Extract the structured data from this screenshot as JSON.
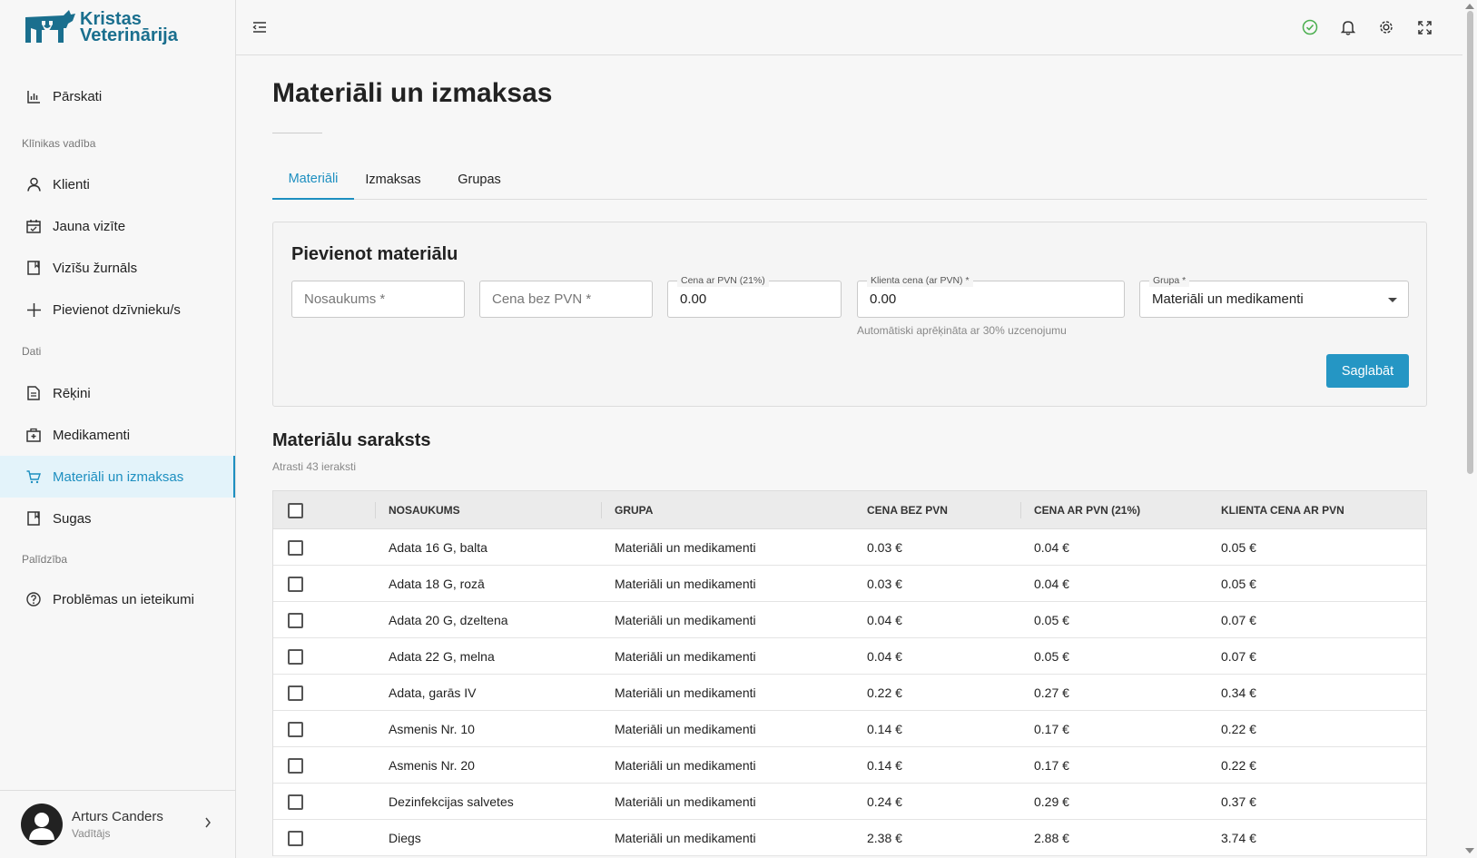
{
  "brand": {
    "line1": "Kristas",
    "line2": "Veterinārija",
    "color": "#1a6f8e"
  },
  "sidebar": {
    "items": [
      {
        "label": "Pārskati",
        "icon": "chart-icon"
      },
      {
        "label": "Klienti",
        "icon": "user-icon"
      },
      {
        "label": "Jauna vizīte",
        "icon": "calendar-icon"
      },
      {
        "label": "Vizīšu žurnāls",
        "icon": "book-icon"
      },
      {
        "label": "Pievienot dzīvnieku/s",
        "icon": "plus-icon"
      },
      {
        "label": "Rēķini",
        "icon": "document-icon"
      },
      {
        "label": "Medikamenti",
        "icon": "medkit-icon"
      },
      {
        "label": "Materiāli un izmaksas",
        "icon": "cart-icon"
      },
      {
        "label": "Sugas",
        "icon": "book-icon"
      },
      {
        "label": "Problēmas un ieteikumi",
        "icon": "help-icon"
      }
    ],
    "sections": [
      "Klīnikas vadība",
      "Dati",
      "Palīdzība"
    ]
  },
  "user": {
    "name": "Arturs Canders",
    "role": "Vadītājs"
  },
  "page": {
    "title": "Materiāli un izmaksas"
  },
  "tabs": [
    {
      "label": "Materiāli"
    },
    {
      "label": "Izmaksas"
    },
    {
      "label": "Grupas"
    }
  ],
  "form": {
    "title": "Pievienot materiālu",
    "name_placeholder": "Nosaukums *",
    "price_placeholder": "Cena bez PVN *",
    "vat_label": "Cena ar PVN (21%)",
    "vat_value": "0.00",
    "client_label": "Klienta cena (ar PVN) *",
    "client_value": "0.00",
    "group_label": "Grupa *",
    "group_value": "Materiāli un medikamenti",
    "helper": "Automātiski aprēķināta ar 30% uzcenojumu",
    "save_label": "Saglabāt"
  },
  "list": {
    "title": "Materiālu saraksts",
    "count": "Atrasti 43 ieraksti",
    "columns": [
      "NOSAUKUMS",
      "GRUPA",
      "CENA BEZ PVN",
      "CENA AR PVN (21%)",
      "KLIENTA CENA AR PVN"
    ],
    "rows": [
      [
        "Adata 16 G, balta",
        "Materiāli un medikamenti",
        "0.03 €",
        "0.04 €",
        "0.05 €"
      ],
      [
        "Adata 18 G, rozā",
        "Materiāli un medikamenti",
        "0.03 €",
        "0.04 €",
        "0.05 €"
      ],
      [
        "Adata 20 G, dzeltena",
        "Materiāli un medikamenti",
        "0.04 €",
        "0.05 €",
        "0.07 €"
      ],
      [
        "Adata 22 G, melna",
        "Materiāli un medikamenti",
        "0.04 €",
        "0.05 €",
        "0.07 €"
      ],
      [
        "Adata, garās IV",
        "Materiāli un medikamenti",
        "0.22 €",
        "0.27 €",
        "0.34 €"
      ],
      [
        "Asmenis Nr. 10",
        "Materiāli un medikamenti",
        "0.14 €",
        "0.17 €",
        "0.22 €"
      ],
      [
        "Asmenis Nr. 20",
        "Materiāli un medikamenti",
        "0.14 €",
        "0.17 €",
        "0.22 €"
      ],
      [
        "Dezinfekcijas salvetes",
        "Materiāli un medikamenti",
        "0.24 €",
        "0.29 €",
        "0.37 €"
      ],
      [
        "Diegs",
        "Materiāli un medikamenti",
        "2.38 €",
        "2.88 €",
        "3.74 €"
      ]
    ]
  },
  "colors": {
    "accent": "#1d8fc0",
    "button": "#2596c4",
    "status_ok": "#4caf50"
  }
}
